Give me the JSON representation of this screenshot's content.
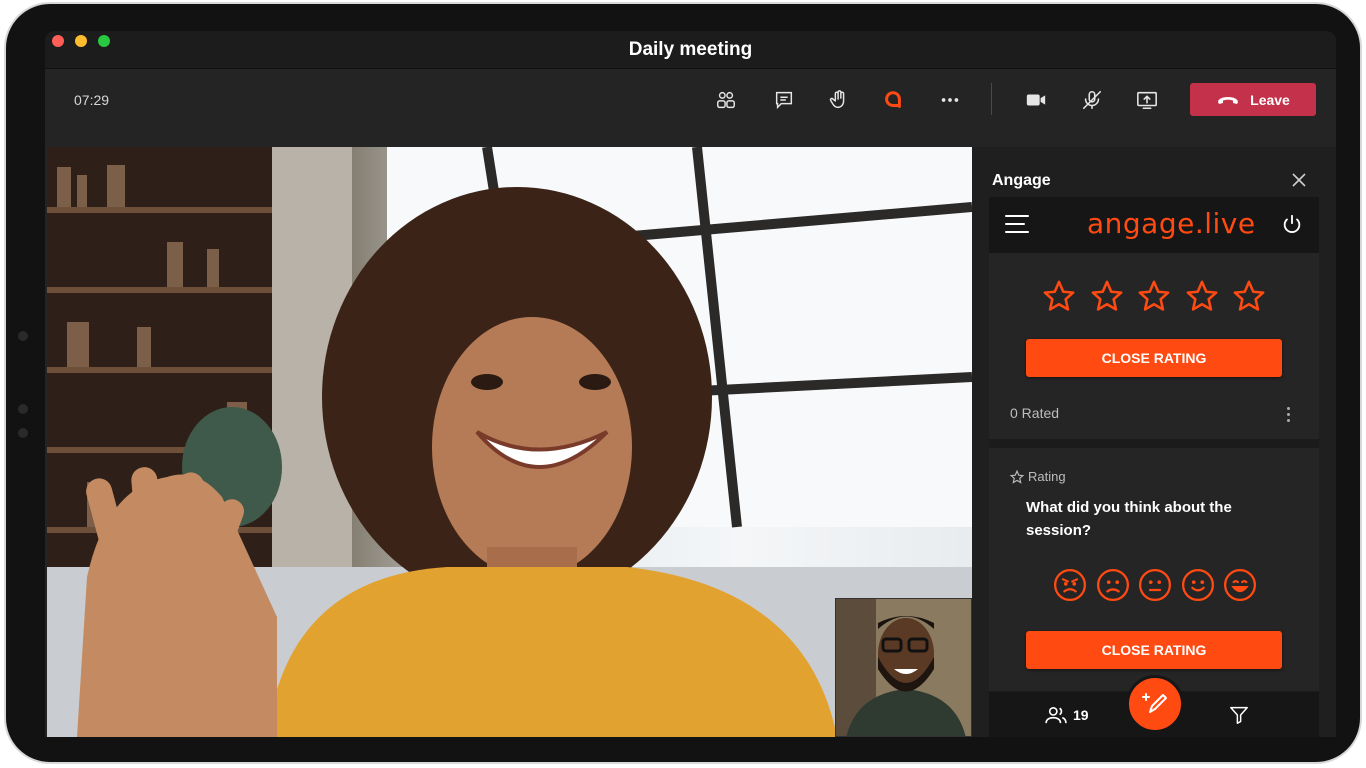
{
  "window": {
    "title": "Daily meeting"
  },
  "toolbar": {
    "time": "07:29",
    "buttons": [
      {
        "name": "participants-icon"
      },
      {
        "name": "chat-icon"
      },
      {
        "name": "raise-hand-icon"
      },
      {
        "name": "angage-app-icon"
      },
      {
        "name": "more-icon"
      },
      {
        "name": "camera-icon"
      },
      {
        "name": "mic-off-icon"
      },
      {
        "name": "share-screen-icon"
      }
    ],
    "leave_label": "Leave"
  },
  "panel": {
    "title": "Angage",
    "brand": "angage.live",
    "rating_card": {
      "stars": 5,
      "close_label": "CLOSE RATING",
      "rated_count": "0 Rated"
    },
    "question_card": {
      "tag": "Rating",
      "question": "What did you think about the session?",
      "emoji_scale": [
        "angry",
        "sad",
        "neutral",
        "smile",
        "laugh"
      ],
      "close_label": "CLOSE RATING"
    },
    "footer": {
      "participants_count": "19"
    }
  },
  "colors": {
    "accent": "#ff4a12",
    "leave": "#c4314b",
    "background": "#242424"
  }
}
